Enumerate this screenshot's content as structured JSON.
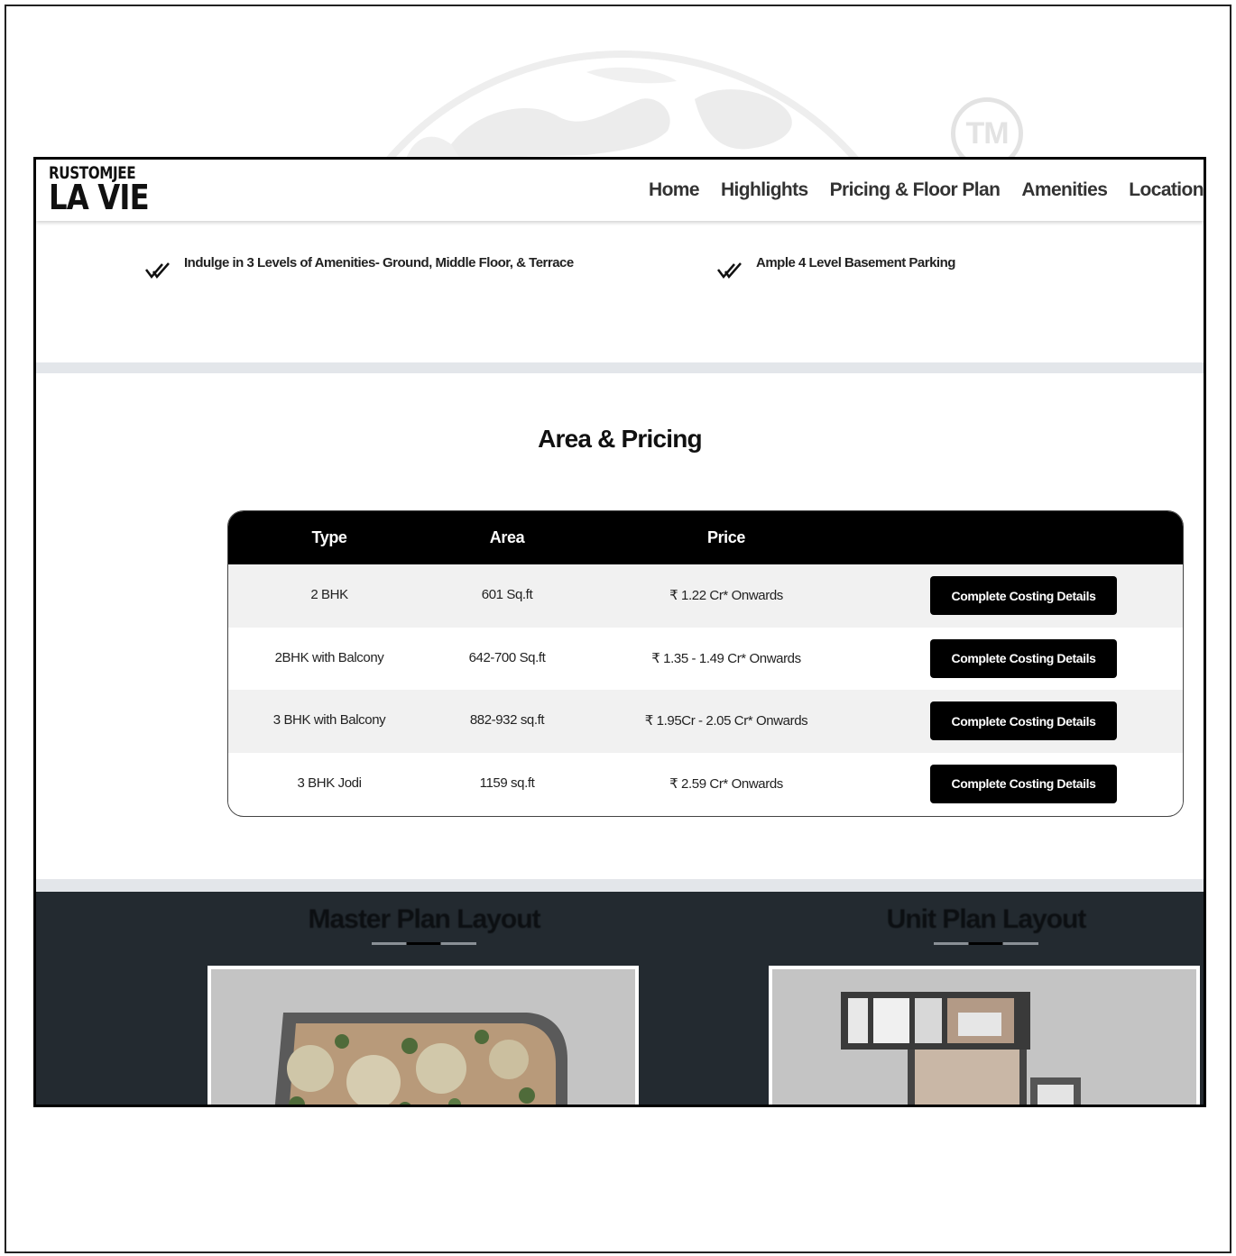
{
  "watermark": {
    "badge_text": "TM"
  },
  "header": {
    "logo_line1": "RUSTOMJEE",
    "logo_line2": "LA VIE",
    "nav": [
      "Home",
      "Highlights",
      "Pricing & Floor Plan",
      "Amenities",
      "Location"
    ]
  },
  "highlights": [
    {
      "icon": "double-check-icon",
      "text": "Indulge in 3 Levels of Amenities- Ground, Middle Floor, & Terrace"
    },
    {
      "icon": "double-check-icon",
      "text": "Ample 4 Level Basement Parking"
    }
  ],
  "pricing": {
    "title": "Area & Pricing",
    "columns": [
      "Type",
      "Area",
      "Price"
    ],
    "rows": [
      {
        "type": "2 BHK",
        "area": "601 Sq.ft",
        "price": "₹ 1.22 Cr* Onwards",
        "button": "Complete Costing Details"
      },
      {
        "type": "2BHK with Balcony",
        "area": "642-700 Sq.ft",
        "price": "₹ 1.35 - 1.49 Cr* Onwards",
        "button": "Complete Costing Details"
      },
      {
        "type": "3 BHK with Balcony",
        "area": "882-932 sq.ft",
        "price": "₹ 1.95Cr - 2.05 Cr* Onwards",
        "button": "Complete Costing Details"
      },
      {
        "type": "3 BHK Jodi",
        "area": "1159 sq.ft",
        "price": "₹ 2.59 Cr* Onwards",
        "button": "Complete Costing Details"
      }
    ]
  },
  "plans": {
    "master_title": "Master Plan Layout",
    "unit_title": "Unit Plan Layout"
  },
  "colors": {
    "header_bg": "#ffffff",
    "table_head": "#000000",
    "button": "#000000",
    "plans_bg": "#232a30",
    "band": "#e3e6ea"
  }
}
